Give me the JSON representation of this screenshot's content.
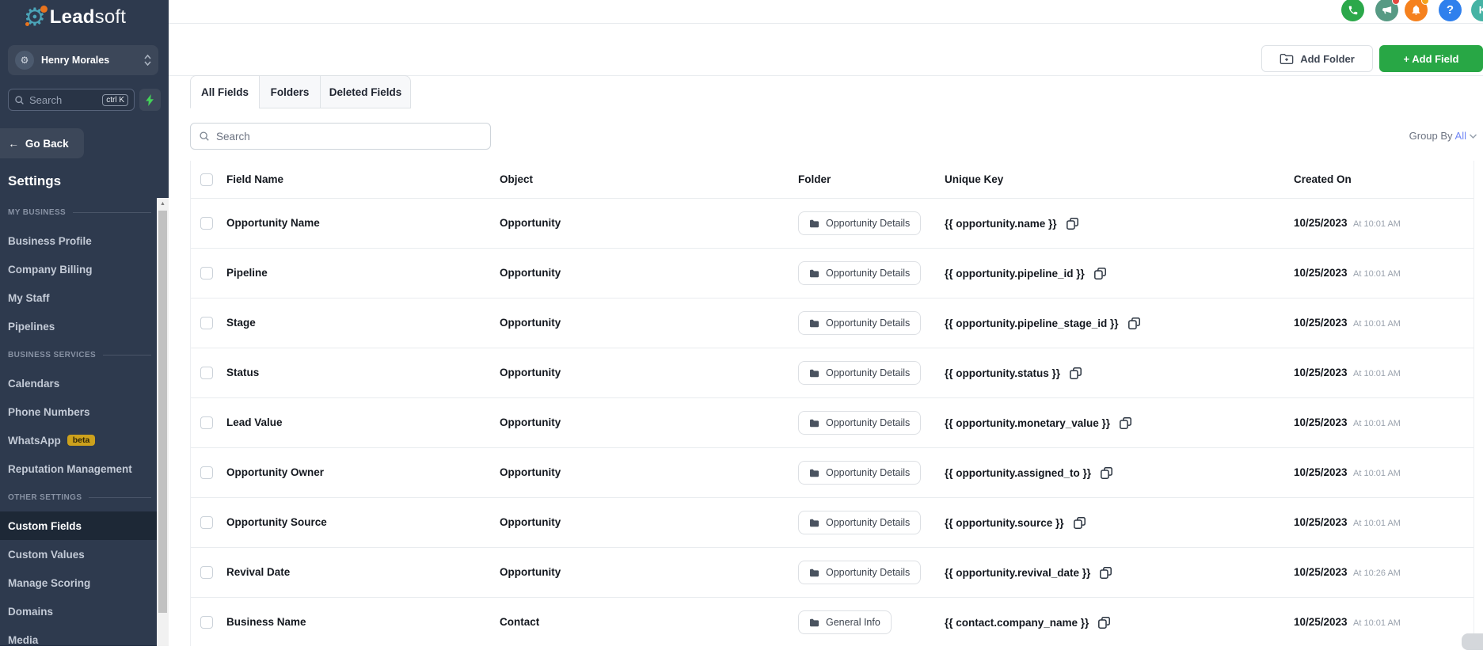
{
  "brand": {
    "logo_bold": "Lead",
    "logo_light": "soft"
  },
  "topbar": {
    "help_label": "?",
    "avatar_initial": "K"
  },
  "sidebar": {
    "workspace_name": "Henry Morales",
    "search": {
      "placeholder": "Search",
      "shortcut": "ctrl K"
    },
    "back_arrow": "←",
    "back_label": "Go Back",
    "title": "Settings",
    "sections": [
      {
        "label": "MY BUSINESS",
        "items": [
          {
            "label": "Business Profile"
          },
          {
            "label": "Company Billing"
          },
          {
            "label": "My Staff"
          },
          {
            "label": "Pipelines"
          }
        ]
      },
      {
        "label": "BUSINESS SERVICES",
        "items": [
          {
            "label": "Calendars"
          },
          {
            "label": "Phone Numbers"
          },
          {
            "label": "WhatsApp",
            "badge": "beta"
          },
          {
            "label": "Reputation Management"
          }
        ]
      },
      {
        "label": "OTHER SETTINGS",
        "items": [
          {
            "label": "Custom Fields",
            "active": true
          },
          {
            "label": "Custom Values"
          },
          {
            "label": "Manage Scoring"
          },
          {
            "label": "Domains"
          },
          {
            "label": "Media"
          }
        ]
      }
    ]
  },
  "toolbar": {
    "add_folder_label": "Add Folder",
    "add_field_label": "+ Add Field"
  },
  "tabs": [
    {
      "label": "All Fields",
      "active": true
    },
    {
      "label": "Folders",
      "active": false
    },
    {
      "label": "Deleted Fields",
      "active": false
    }
  ],
  "filter_bar": {
    "search_placeholder": "Search",
    "group_by_label": "Group By",
    "group_by_value": "All"
  },
  "table": {
    "columns": [
      "Field Name",
      "Object",
      "Folder",
      "Unique Key",
      "Created On"
    ],
    "rows": [
      {
        "field_name": "Opportunity Name",
        "object": "Opportunity",
        "folder": "Opportunity Details",
        "unique_key": "{{ opportunity.name }}",
        "created_date": "10/25/2023",
        "created_time": "At 10:01 AM"
      },
      {
        "field_name": "Pipeline",
        "object": "Opportunity",
        "folder": "Opportunity Details",
        "unique_key": "{{ opportunity.pipeline_id }}",
        "created_date": "10/25/2023",
        "created_time": "At 10:01 AM"
      },
      {
        "field_name": "Stage",
        "object": "Opportunity",
        "folder": "Opportunity Details",
        "unique_key": "{{ opportunity.pipeline_stage_id }}",
        "created_date": "10/25/2023",
        "created_time": "At 10:01 AM"
      },
      {
        "field_name": "Status",
        "object": "Opportunity",
        "folder": "Opportunity Details",
        "unique_key": "{{ opportunity.status }}",
        "created_date": "10/25/2023",
        "created_time": "At 10:01 AM"
      },
      {
        "field_name": "Lead Value",
        "object": "Opportunity",
        "folder": "Opportunity Details",
        "unique_key": "{{ opportunity.monetary_value }}",
        "created_date": "10/25/2023",
        "created_time": "At 10:01 AM"
      },
      {
        "field_name": "Opportunity Owner",
        "object": "Opportunity",
        "folder": "Opportunity Details",
        "unique_key": "{{ opportunity.assigned_to }}",
        "created_date": "10/25/2023",
        "created_time": "At 10:01 AM"
      },
      {
        "field_name": "Opportunity Source",
        "object": "Opportunity",
        "folder": "Opportunity Details",
        "unique_key": "{{ opportunity.source }}",
        "created_date": "10/25/2023",
        "created_time": "At 10:01 AM"
      },
      {
        "field_name": "Revival Date",
        "object": "Opportunity",
        "folder": "Opportunity Details",
        "unique_key": "{{ opportunity.revival_date }}",
        "created_date": "10/25/2023",
        "created_time": "At 10:26 AM"
      },
      {
        "field_name": "Business Name",
        "object": "Contact",
        "folder": "General Info",
        "unique_key": "{{ contact.company_name }}",
        "created_date": "10/25/2023",
        "created_time": "At 10:01 AM"
      }
    ]
  },
  "colors": {
    "sidebar_bg": "#2e3a4e",
    "sidebar_active_bg": "#1d2836",
    "logo_teal": "#4ba4b8",
    "logo_orange": "#e8731d",
    "add_field_green": "#28a745",
    "phone_green": "#2ba84a",
    "megaphone_teal": "#579a84",
    "bell_orange": "#f5811e",
    "help_blue": "#2f80ed",
    "avatar_teal": "#45b3a4",
    "beta_badge_yellow": "#cda11c",
    "group_by_value_blue": "#7187f5",
    "bolt_green": "#43d158",
    "row_border": "#e9ecef"
  }
}
